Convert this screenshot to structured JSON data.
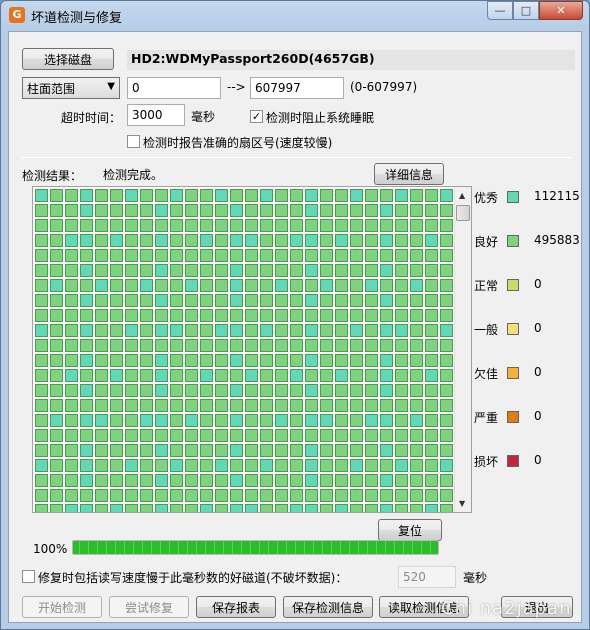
{
  "window": {
    "title": "坏道检测与修复",
    "app_icon_glyph": "G"
  },
  "disk": {
    "select_button": "选择磁盘",
    "name": "HD2:WDMyPassport260D(4657GB)"
  },
  "range": {
    "mode": "柱面范围",
    "start": "0",
    "arrow": "-->",
    "end": "607997",
    "hint": "(0-607997)"
  },
  "timeout": {
    "label": "超时时间：",
    "value": "3000",
    "unit": "毫秒"
  },
  "options": {
    "prevent_sleep": {
      "label": "检测时阻止系统睡眠",
      "checked": true
    },
    "report_sector": {
      "label": "检测时报告准确的扇区号(速度较慢)",
      "checked": false
    }
  },
  "results": {
    "label": "检测结果：",
    "status": "检测完成。",
    "detail_button": "详细信息"
  },
  "legend": [
    {
      "name": "优秀",
      "count": "112115",
      "color": "#5fd9b6"
    },
    {
      "name": "良好",
      "count": "495883",
      "color": "#7ed47e"
    },
    {
      "name": "正常",
      "count": "0",
      "color": "#c9d96a"
    },
    {
      "name": "一般",
      "count": "0",
      "color": "#f1df7a"
    },
    {
      "name": "欠佳",
      "count": "0",
      "color": "#f5b236"
    },
    {
      "name": "严重",
      "count": "0",
      "color": "#e07d10"
    },
    {
      "name": "损坏",
      "count": "0",
      "color": "#c0283a"
    }
  ],
  "repair_button": "复位",
  "progress": {
    "label": "100%",
    "value": 1.0
  },
  "repair_option": {
    "label": "修复时包括读写速度慢于此毫秒数的好磁道(不破坏数据)：",
    "checked": false,
    "value": "520",
    "unit": "毫秒"
  },
  "bottom_buttons": {
    "start": "开始检测",
    "try_repair": "尝试修复",
    "save_report": "保存报表",
    "save_info": "保存检测信息",
    "load_info": "读取检测信息",
    "exit": "退出"
  },
  "watermark": "Chi na2japan",
  "icons": {
    "minimize": "minimize-icon",
    "maximize": "maximize-icon",
    "close": "close-icon",
    "dropdown": "chevron-down-icon"
  }
}
